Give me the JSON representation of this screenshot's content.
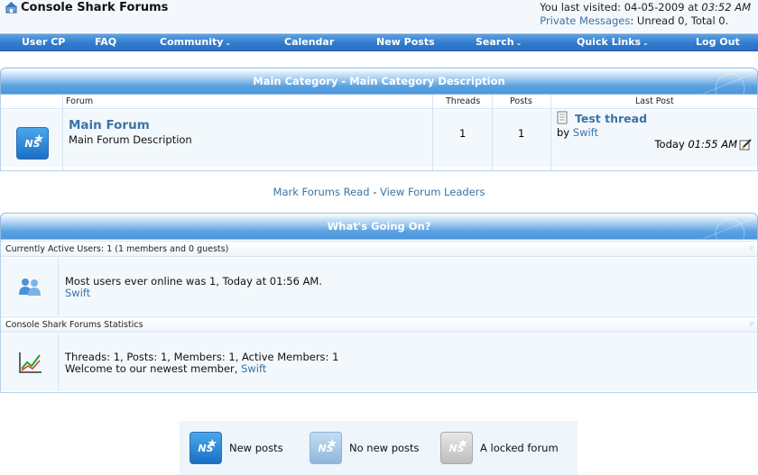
{
  "header": {
    "site_title": "Console Shark Forums",
    "last_visited_label": "You last visited:",
    "last_visited_date": "04-05-2009 at",
    "last_visited_time": "03:52 AM",
    "pm_link": "Private Messages",
    "pm_status": ": Unread 0, Total 0."
  },
  "navbar": {
    "items": [
      {
        "label": "User CP",
        "dropdown": false
      },
      {
        "label": "FAQ",
        "dropdown": false
      },
      {
        "label": "Community",
        "dropdown": true
      },
      {
        "label": "Calendar",
        "dropdown": false
      },
      {
        "label": "New Posts",
        "dropdown": false
      },
      {
        "label": "Search",
        "dropdown": true
      },
      {
        "label": "Quick Links",
        "dropdown": true
      },
      {
        "label": "Log Out",
        "dropdown": false
      }
    ],
    "chevron": "⌄"
  },
  "category": {
    "title": "Main Category - Main Category Description",
    "columns": {
      "forum": "Forum",
      "threads": "Threads",
      "posts": "Posts",
      "last_post": "Last Post"
    },
    "forum": {
      "icon": "NS",
      "title": "Main Forum",
      "description": "Main Forum Description",
      "threads": "1",
      "posts": "1",
      "last_post_title": "Test thread",
      "last_post_by": "by",
      "last_post_user": "Swift",
      "last_post_day": "Today",
      "last_post_time": "01:55 AM"
    }
  },
  "links": {
    "mark_read": "Mark Forums Read",
    "separator": "-",
    "leaders": "View Forum Leaders"
  },
  "whats_going_on": {
    "title": "What's Going On?",
    "active_users": {
      "header": "Currently Active Users: 1 (1 members and 0 guests)",
      "line1": "Most users ever online was 1, Today at 01:56 AM.",
      "user": "Swift"
    },
    "stats": {
      "header": "Console Shark Forums Statistics",
      "line1": "Threads: 1, Posts: 1, Members: 1, Active Members: 1",
      "newest_label": "Welcome to our newest member,",
      "newest_user": "Swift"
    }
  },
  "legend": {
    "icon": "NS",
    "new_posts": "New posts",
    "no_new_posts": "No new posts",
    "locked": "A locked forum"
  },
  "colors": {
    "link": "#3a73a8",
    "nav": "#2f7ccf",
    "row_bg": "#f3f8fd"
  }
}
